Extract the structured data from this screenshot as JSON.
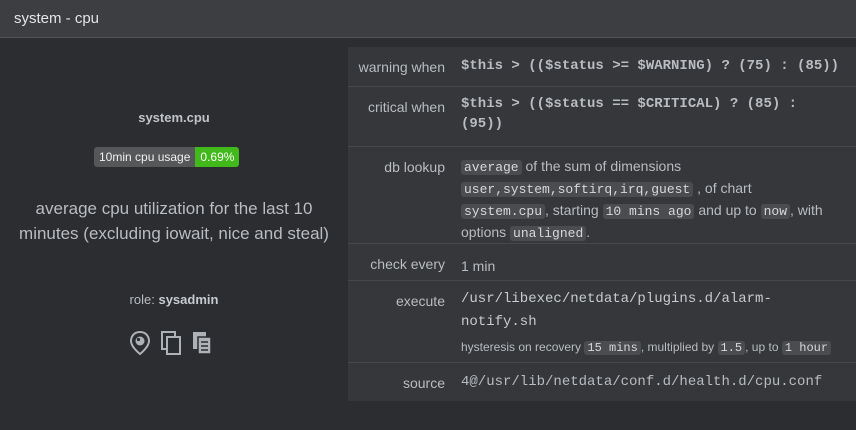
{
  "header": {
    "title": "system - cpu"
  },
  "left": {
    "chart_name": "system.cpu",
    "badge": {
      "label": "10min cpu usage",
      "value": "0.69%",
      "value_color": "#41b91a"
    },
    "description": "average cpu utilization for the last 10 minutes (excluding iowait, nice and steal)",
    "role_label": "role:",
    "role_value": "sysadmin",
    "icons": [
      "pin-eye-icon",
      "copy-icon",
      "copy-docs-icon"
    ]
  },
  "rows": {
    "warning": {
      "key": "warning when",
      "value": "$this > (($status >= $WARNING) ? (75) : (85))"
    },
    "critical": {
      "key": "critical when",
      "value": "$this > (($status == $CRITICAL) ? (85) : (95))"
    },
    "lookup": {
      "key": "db lookup",
      "method": "average",
      "t1": "of the sum of dimensions",
      "dimensions": "user,system,softirq,irq,guest",
      "t2": ", of chart",
      "chart": "system.cpu",
      "t3": ", starting",
      "after": "10 mins ago",
      "t4": "and up to",
      "before": "now",
      "t5": ", with options",
      "options": "unaligned",
      "t6": "."
    },
    "every": {
      "key": "check every",
      "value": "1 min"
    },
    "execute": {
      "key": "execute",
      "command": "/usr/libexec/netdata/plugins.d/alarm-notify.sh",
      "h1": "hysteresis on recovery",
      "delay": "15 mins",
      "h2": ", multiplied by",
      "multiplier": "1.5",
      "h3": ", up to",
      "max": "1 hour"
    },
    "source": {
      "key": "source",
      "value": "4@/usr/lib/netdata/conf.d/health.d/cpu.conf"
    }
  }
}
